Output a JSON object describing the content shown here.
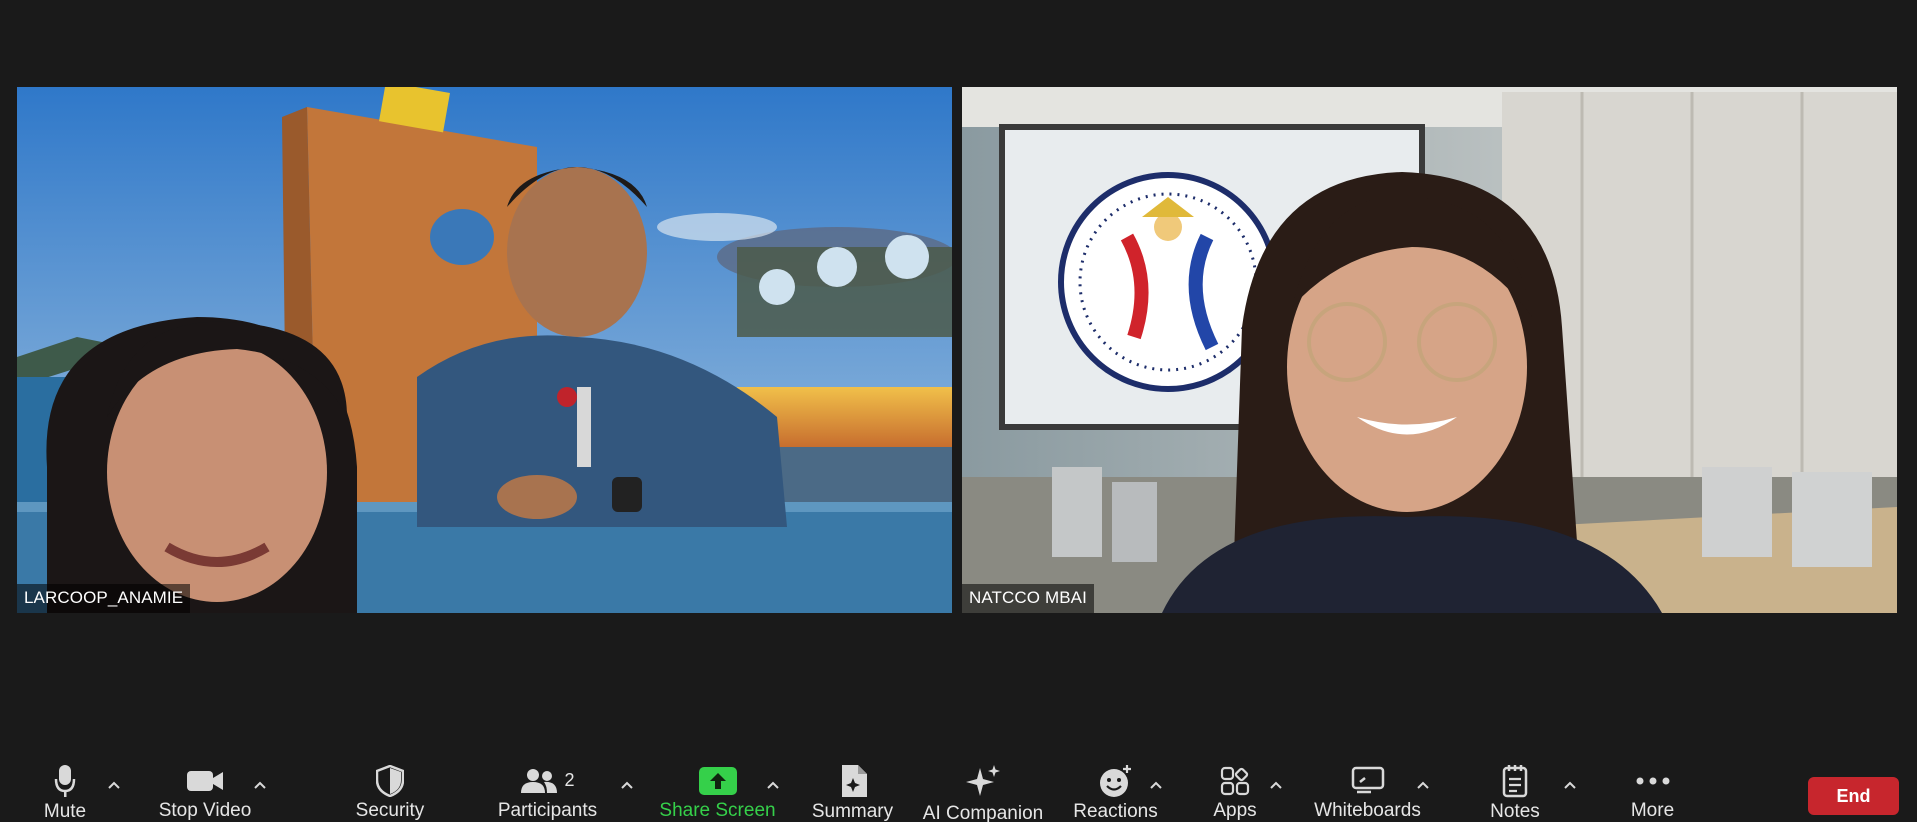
{
  "participants": [
    {
      "name": "LARCOOP_ANAMIE"
    },
    {
      "name": "NATCCO MBAI"
    }
  ],
  "toolbar": {
    "mute_label": "Mute",
    "stop_video_label": "Stop Video",
    "security_label": "Security",
    "participants_label": "Participants",
    "participants_count": "2",
    "share_screen_label": "Share Screen",
    "summary_label": "Summary",
    "ai_companion_label": "AI Companion",
    "reactions_label": "Reactions",
    "apps_label": "Apps",
    "whiteboards_label": "Whiteboards",
    "notes_label": "Notes",
    "more_label": "More",
    "end_label": "End"
  },
  "colors": {
    "background": "#1a1a1a",
    "share_green": "#35d04a",
    "end_red": "#c7262d"
  },
  "icons": [
    "microphone-icon",
    "video-camera-icon",
    "shield-icon",
    "people-icon",
    "share-arrow-icon",
    "summary-doc-icon",
    "sparkle-icon",
    "smiley-plus-icon",
    "apps-grid-icon",
    "whiteboard-icon",
    "notes-icon",
    "more-dots-icon",
    "chevron-up-icon"
  ]
}
